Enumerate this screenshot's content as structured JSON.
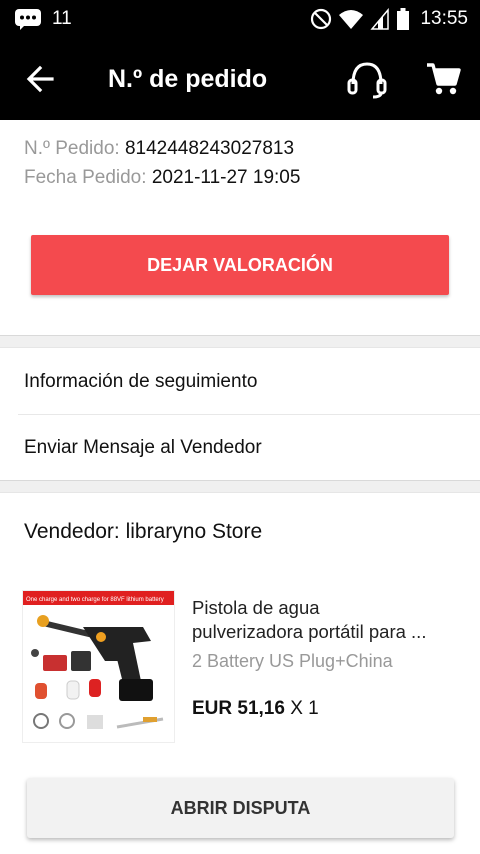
{
  "status_bar": {
    "notification_count": "11",
    "time": "13:55"
  },
  "app_bar": {
    "title": "N.º de pedido"
  },
  "order": {
    "number_label": "N.º Pedido:",
    "number_value": "8142448243027813",
    "date_label": "Fecha Pedido:",
    "date_value": "2021-11-27 19:05"
  },
  "actions": {
    "leave_review": "DEJAR VALORACIÓN",
    "open_dispute": "ABRIR DISPUTA"
  },
  "menu": {
    "tracking": "Información de seguimiento",
    "message_seller": "Enviar Mensaje al Vendedor"
  },
  "seller": {
    "label": "Vendedor: libraryno Store"
  },
  "product": {
    "title_line1": "Pistola de agua",
    "title_line2": "pulverizadora portátil para ...",
    "variant": "2 Battery US Plug+China",
    "price": "EUR 51,16",
    "quantity": "X 1",
    "banner_text": "One charge and two charge for 88VF lithium battery"
  },
  "colors": {
    "accent": "#f44a4e",
    "app_bar": "#000000",
    "muted_text": "#999999"
  }
}
